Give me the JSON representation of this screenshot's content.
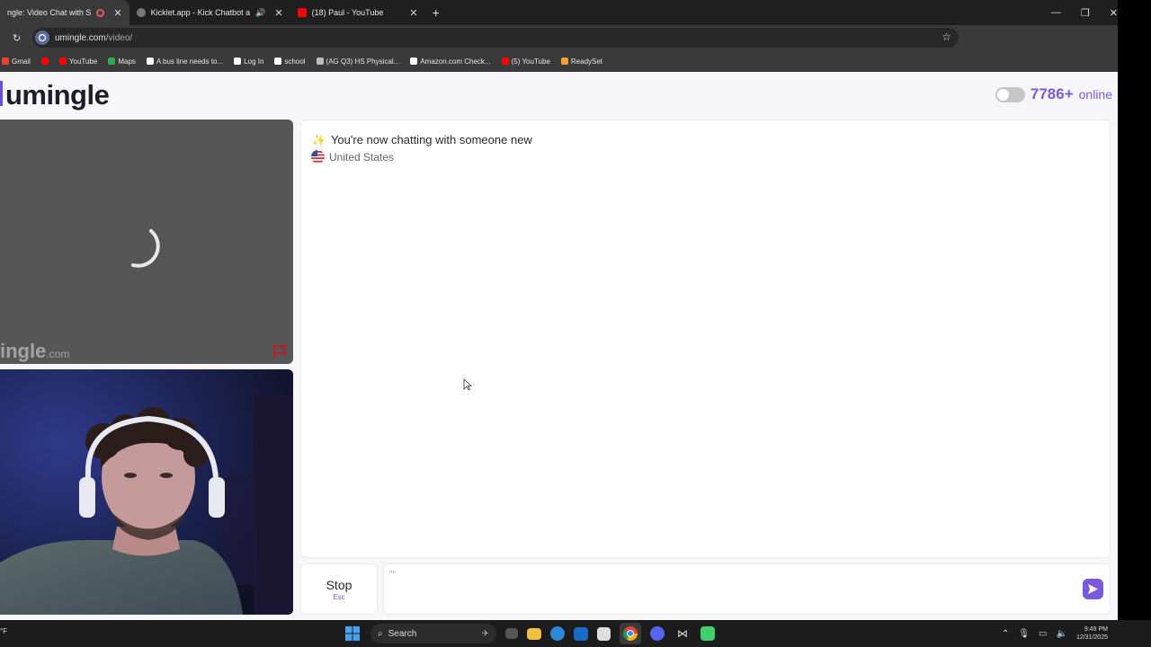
{
  "browser": {
    "tabs": [
      {
        "title": "ngle: Video Chat with S",
        "active": true,
        "status": "recording"
      },
      {
        "title": "Kicklet.app - Kick Chatbot a",
        "active": false,
        "status": "audio"
      },
      {
        "title": "(18) Paul - YouTube",
        "active": false,
        "status": ""
      }
    ],
    "new_tab": "+",
    "url_host": "umingle.com",
    "url_path": "/video/",
    "bookmarks": [
      {
        "label": "Gmail",
        "icon": "gmail-icon",
        "color": "#ea4335"
      },
      {
        "label": "",
        "icon": "youtube-icon",
        "color": "#ff0000"
      },
      {
        "label": "YouTube",
        "icon": "youtube-icon",
        "color": "#ff0000"
      },
      {
        "label": "Maps",
        "icon": "maps-icon",
        "color": "#34a853"
      },
      {
        "label": "A bus line needs to...",
        "icon": "doc-icon",
        "color": "#ffffff"
      },
      {
        "label": "Log In",
        "icon": "login-icon",
        "color": "#ffffff"
      },
      {
        "label": "school",
        "icon": "school-icon",
        "color": "#ffffff"
      },
      {
        "label": "(AG Q3) HS Physical...",
        "icon": "globe-icon",
        "color": "#bbbbbb"
      },
      {
        "label": "Amazon.com Check...",
        "icon": "amazon-icon",
        "color": "#ffffff"
      },
      {
        "label": "(5) YouTube",
        "icon": "youtube-icon",
        "color": "#ff0000"
      },
      {
        "label": "ReadySet",
        "icon": "readyset-icon",
        "color": "#f0a030"
      }
    ]
  },
  "site": {
    "logo": "umingle",
    "online_count": "7786+",
    "online_label": "online",
    "watermark_name": "ingle",
    "watermark_suffix": ".com",
    "accent": "#7a5ad8"
  },
  "chat": {
    "system_message": "You're now chatting with someone new",
    "country": "United States",
    "stop_label": "Stop",
    "stop_key": "Esc",
    "input_value": "''''"
  },
  "taskbar": {
    "weather": "°F",
    "search_placeholder": "Search",
    "time": "9:49 PM",
    "date": "12/31/2025"
  }
}
